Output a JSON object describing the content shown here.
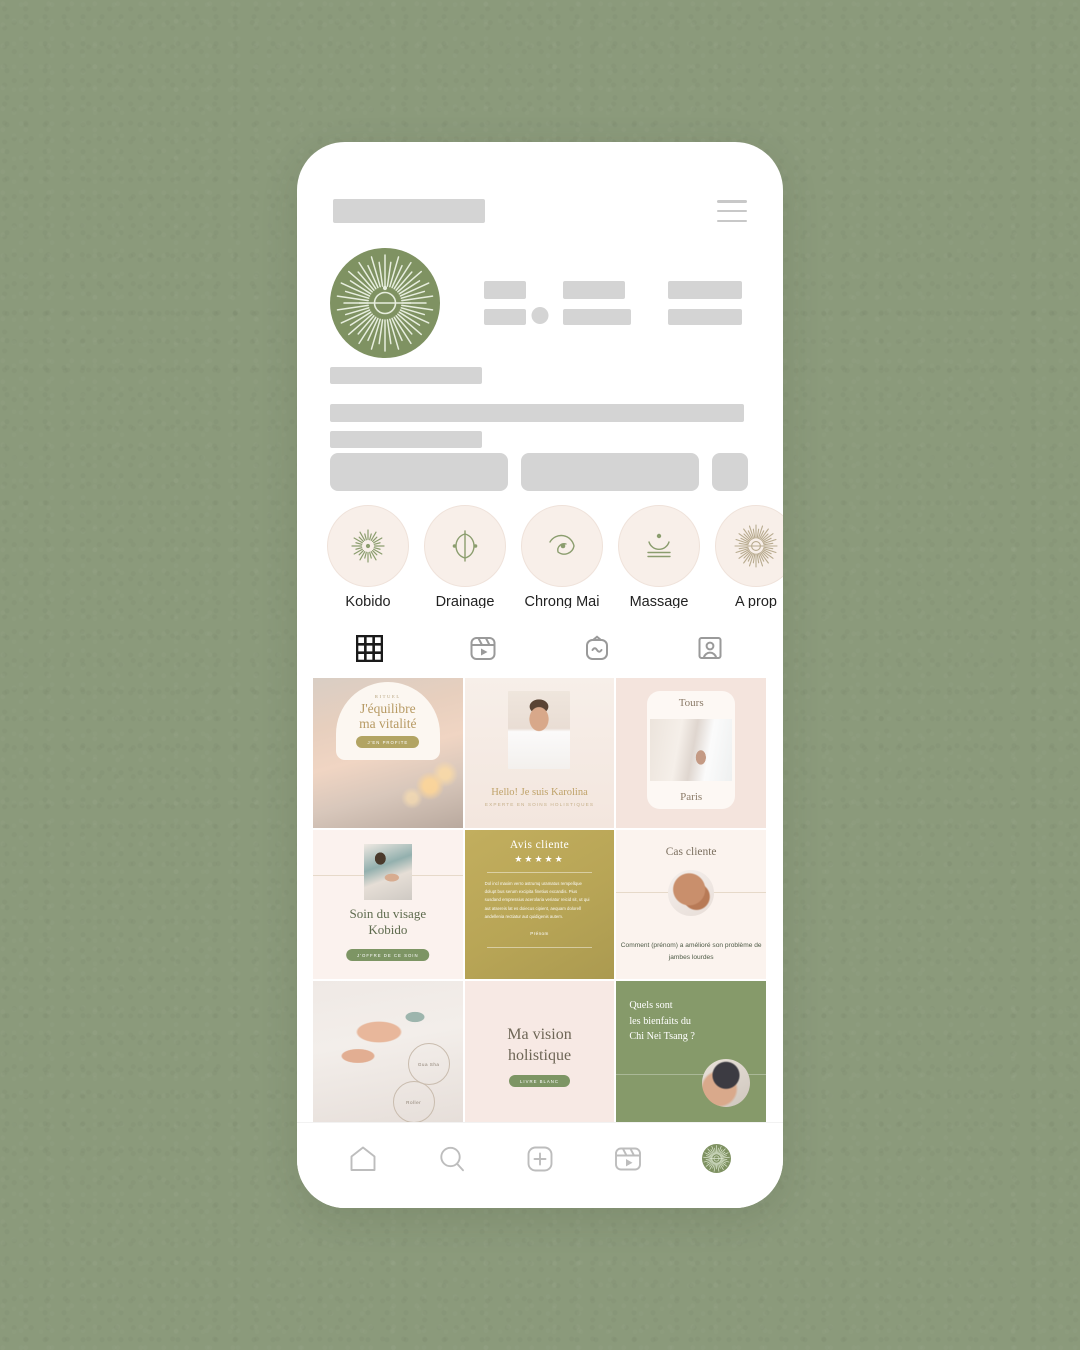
{
  "theme": {
    "background_color": "#8b9a7b",
    "phone_color": "#ffffff",
    "brand_green": "#7f9262",
    "brand_gold": "#b8a556",
    "blush": "#f7e9e4"
  },
  "profile": {
    "avatar_icon": "sunburst-logo-icon",
    "menu_icon": "hamburger-menu-icon",
    "stats_placeholder_count": 3
  },
  "highlights": {
    "items": [
      {
        "label": "Kobido",
        "icon": "sunburst-dot-icon"
      },
      {
        "label": "Drainage",
        "icon": "leaf-split-icon"
      },
      {
        "label": "Chrong Mai",
        "icon": "spiral-orbit-icon"
      },
      {
        "label": "Massage",
        "icon": "bowl-dot-icon"
      },
      {
        "label": "A prop",
        "icon": "sunburst-logo-icon"
      }
    ]
  },
  "feed_tabs": [
    {
      "name": "grid",
      "icon": "grid-icon",
      "active": true
    },
    {
      "name": "reels",
      "icon": "reels-icon",
      "active": false
    },
    {
      "name": "igtv",
      "icon": "igtv-icon",
      "active": false
    },
    {
      "name": "tagged",
      "icon": "tagged-person-icon",
      "active": false
    }
  ],
  "posts": [
    {
      "id": "post-rituel",
      "kicker": "RITUEL",
      "title_line1": "J'équilibre",
      "title_line2": "ma vitalité",
      "button": "J'EN PROFITE"
    },
    {
      "id": "post-karolina",
      "name": "Hello! Je suis Karolina",
      "subtitle": "EXPERTE EN SOINS HOLISTIQUES"
    },
    {
      "id": "post-villes",
      "city_top": "Tours",
      "city_bottom": "Paris"
    },
    {
      "id": "post-kobido",
      "title_line1": "Soin du visage",
      "title_line2": "Kobido",
      "button": "J'OFFRE DE CE SOIN"
    },
    {
      "id": "post-avis",
      "title": "Avis cliente",
      "stars": "★★★★★",
      "rating": 5,
      "body": "Dol incl maxim verro astrumq uramatus rempellque dolupt bus serum excipita finetius excandis. Pius susdand empressius acerolaria veriatur reicid sit, ut qui aut atsereis lat es doiecus cipient, aequam dolorell andellenia rectiatur aut quidigenis autem.",
      "signature": "Prénom"
    },
    {
      "id": "post-cas-cliente",
      "title": "Cas cliente",
      "body": "Comment (prénom) a amélioré son problème de jambes lourdes"
    },
    {
      "id": "post-guasha",
      "tag1": "Gua Sha",
      "tag2": "Roller"
    },
    {
      "id": "post-vision",
      "title_line1": "Ma vision",
      "title_line2": "holistique",
      "button": "LIVRE BLANC"
    },
    {
      "id": "post-chineitsang",
      "line1": "Quels sont",
      "line2": "les bienfaits du",
      "line3": "Chi Nei Tsang ?"
    }
  ],
  "bottom_nav": [
    {
      "name": "home",
      "icon": "home-icon"
    },
    {
      "name": "search",
      "icon": "search-icon"
    },
    {
      "name": "create",
      "icon": "plus-square-icon"
    },
    {
      "name": "reels",
      "icon": "reels-icon"
    },
    {
      "name": "profile",
      "icon": "profile-avatar-icon"
    }
  ]
}
